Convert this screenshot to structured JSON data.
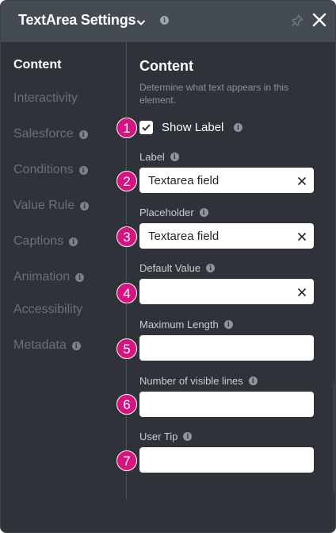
{
  "header": {
    "title": "TextArea Settings",
    "info_icon": "info-icon",
    "pin_icon": "pin-icon",
    "close_icon": "close-icon"
  },
  "sidebar": {
    "items": [
      {
        "label": "Content",
        "active": true,
        "info": false
      },
      {
        "label": "Interactivity",
        "active": false,
        "info": false
      },
      {
        "label": "Salesforce",
        "active": false,
        "info": true
      },
      {
        "label": "Conditions",
        "active": false,
        "info": true
      },
      {
        "label": "Value Rule",
        "active": false,
        "info": true
      },
      {
        "label": "Captions",
        "active": false,
        "info": true
      },
      {
        "label": "Animation",
        "active": false,
        "info": true
      },
      {
        "label": "Accessibility",
        "active": false,
        "info": false
      },
      {
        "label": "Metadata",
        "active": false,
        "info": true
      }
    ]
  },
  "main": {
    "title": "Content",
    "description": "Determine what text appears in this element.",
    "show_label": {
      "label": "Show Label",
      "checked": true
    },
    "fields": [
      {
        "label": "Label",
        "value": "Textarea field",
        "clearable": true
      },
      {
        "label": "Placeholder",
        "value": "Textarea field",
        "clearable": true
      },
      {
        "label": "Default Value",
        "value": "",
        "clearable": true
      },
      {
        "label": "Maximum Length",
        "value": "",
        "clearable": false
      },
      {
        "label": "Number of visible lines",
        "value": "",
        "clearable": false
      },
      {
        "label": "User Tip",
        "value": "",
        "clearable": false
      }
    ]
  },
  "badges": [
    "1",
    "2",
    "3",
    "4",
    "5",
    "6",
    "7"
  ],
  "info_glyph": "i",
  "colors": {
    "panel": "#2f3339",
    "header": "#454b53",
    "badge": "#d6137e",
    "text_active": "#ffffff",
    "text_inactive": "#6a7078"
  }
}
